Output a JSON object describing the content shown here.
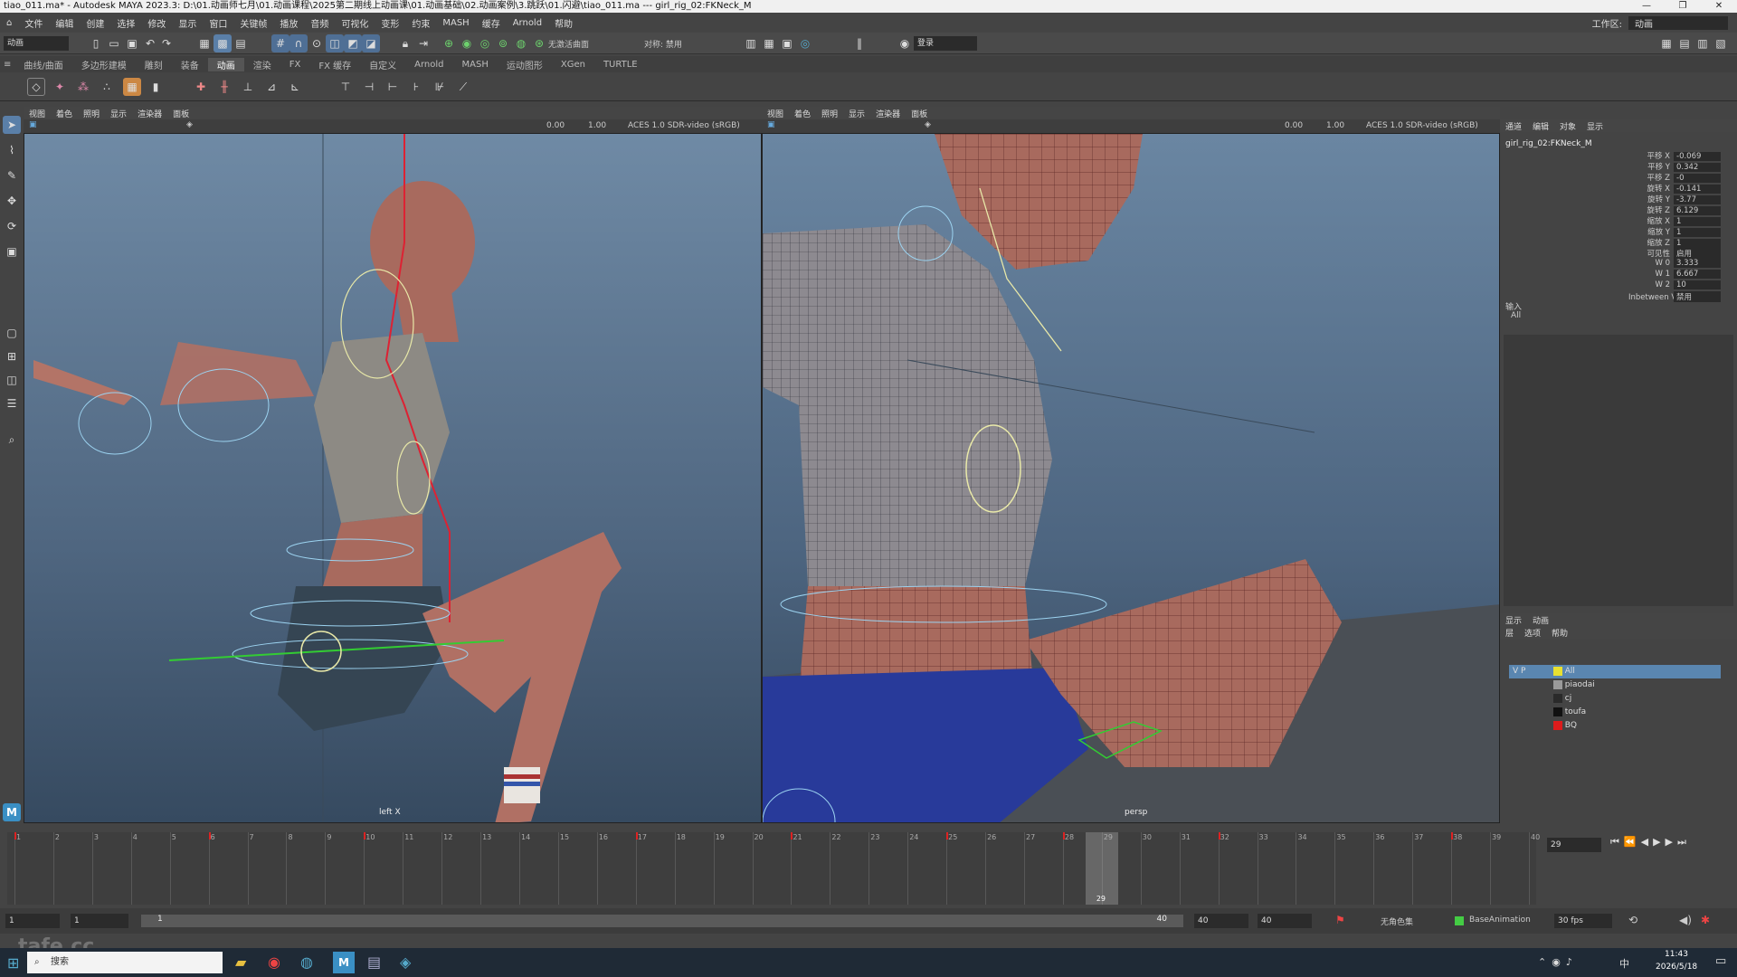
{
  "window": {
    "title": "tiao_011.ma* - Autodesk MAYA 2023.3: D:\\01.动画师七月\\01.动画课程\\2025第二期线上动画课\\01.动画基础\\02.动画案例\\3.跳跃\\01.闪避\\tiao_011.ma --- girl_rig_02:FKNeck_M",
    "controls": [
      "—",
      "❐",
      "✕"
    ]
  },
  "menubar": {
    "items": [
      "文件",
      "编辑",
      "创建",
      "选择",
      "修改",
      "显示",
      "窗口",
      "关键帧",
      "播放",
      "音频",
      "可视化",
      "变形",
      "约束",
      "MASH",
      "缓存",
      "Arnold",
      "帮助"
    ],
    "workspace_label": "工作区:",
    "workspace_value": "动画"
  },
  "statusline": {
    "mode": "动画",
    "no_live_surface": "无激活曲面",
    "symmetry": "对称: 禁用",
    "login": "登录"
  },
  "shelf_tabs": [
    "曲线/曲面",
    "多边形建模",
    "雕刻",
    "装备",
    "动画",
    "渲染",
    "FX",
    "FX 缓存",
    "自定义",
    "Arnold",
    "MASH",
    "运动图形",
    "XGen",
    "TURTLE"
  ],
  "shelf_active_tab": "动画",
  "left_panel": {
    "menu": [
      "视图",
      "着色",
      "照明",
      "显示",
      "渲染器",
      "面板"
    ],
    "num1": "0.00",
    "num2": "1.00",
    "colorspace": "ACES 1.0 SDR-video (sRGB)",
    "camera_label": "left X"
  },
  "right_panel": {
    "menu": [
      "视图",
      "着色",
      "照明",
      "显示",
      "渲染器",
      "面板"
    ],
    "num1": "0.00",
    "num2": "1.00",
    "colorspace": "ACES 1.0 SDR-video (sRGB)",
    "camera_label": "persp"
  },
  "channel_box": {
    "tabs": [
      "通道",
      "编辑",
      "对象",
      "显示"
    ],
    "node": "girl_rig_02:FKNeck_M",
    "attributes": [
      {
        "name": "平移 X",
        "value": "-0.069"
      },
      {
        "name": "平移 Y",
        "value": "0.342"
      },
      {
        "name": "平移 Z",
        "value": "-0"
      },
      {
        "name": "旋转 X",
        "value": "-0.141"
      },
      {
        "name": "旋转 Y",
        "value": "-3.77"
      },
      {
        "name": "旋转 Z",
        "value": "6.129"
      },
      {
        "name": "缩放 X",
        "value": "1"
      },
      {
        "name": "缩放 Y",
        "value": "1"
      },
      {
        "name": "缩放 Z",
        "value": "1"
      },
      {
        "name": "可见性",
        "value": "启用"
      },
      {
        "name": "W 0",
        "value": "3.333"
      },
      {
        "name": "W 1",
        "value": "6.667"
      },
      {
        "name": "W 2",
        "value": "10"
      },
      {
        "name": "Inbetween Vis",
        "value": "禁用"
      }
    ],
    "inputs_label": "输入",
    "inputs_value": "All"
  },
  "layer_editor": {
    "tabs": [
      "显示",
      "动画"
    ],
    "menu": [
      "层",
      "选项",
      "帮助"
    ],
    "layers": [
      {
        "flags": "V P",
        "name": "All",
        "color": "#e8e030"
      },
      {
        "flags": "",
        "name": "piaodai",
        "color": "#9a9a9a"
      },
      {
        "flags": "",
        "name": "cj",
        "color": "#2a2a2a"
      },
      {
        "flags": "",
        "name": "toufa",
        "color": "#111111"
      },
      {
        "flags": "",
        "name": "BQ",
        "color": "#dd1c1c"
      }
    ]
  },
  "timeline": {
    "start": 1,
    "end": 40,
    "current_frame": "29",
    "current_field": "29",
    "labels": [
      "1",
      "2",
      "3",
      "4",
      "5",
      "6",
      "7",
      "8",
      "9",
      "10",
      "11",
      "12",
      "13",
      "14",
      "15",
      "16",
      "17",
      "18",
      "19",
      "20",
      "21",
      "22",
      "23",
      "24",
      "25",
      "26",
      "27",
      "28",
      "29",
      "30",
      "31",
      "32",
      "33",
      "34",
      "35",
      "36",
      "37",
      "38",
      "39",
      "40"
    ],
    "keyframes": [
      1,
      6,
      10,
      17,
      21,
      25,
      28,
      32,
      38
    ]
  },
  "range_bar": {
    "start_field": "1",
    "start_inner": "1",
    "range_start": "1",
    "range_end": "40",
    "end_inner": "40",
    "end_field": "40",
    "char_set": "无角色集",
    "anim_layer": "BaseAnimation",
    "fps": "30 fps"
  },
  "taskbar": {
    "search_placeholder": "搜索",
    "time": "11:43",
    "date": "2026/5/18",
    "ime": "中",
    "watermark": "tafe.cc"
  },
  "colors": {
    "accent": "#5aa0d8",
    "key_red": "#dd2222",
    "viewport_top": "#6f8aa5",
    "viewport_bottom": "#364a60"
  }
}
